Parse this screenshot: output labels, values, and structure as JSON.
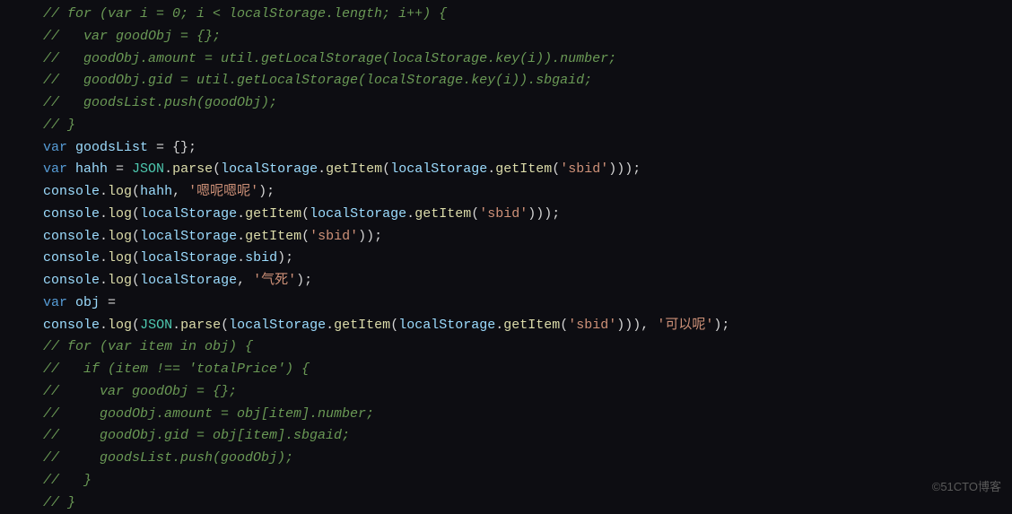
{
  "lines": [
    {
      "type": "comment",
      "text": "// for (var i = 0; i < localStorage.length; i++) {"
    },
    {
      "type": "comment",
      "text": "//   var goodObj = {};"
    },
    {
      "type": "comment",
      "text": "//   goodObj.amount = util.getLocalStorage(localStorage.key(i)).number;"
    },
    {
      "type": "comment",
      "text": "//   goodObj.gid = util.getLocalStorage(localStorage.key(i)).sbgaid;"
    },
    {
      "type": "comment",
      "text": "//   goodsList.push(goodObj);"
    },
    {
      "type": "comment",
      "text": "// }"
    },
    {
      "type": "code",
      "tokens": [
        [
          "keyword",
          "var "
        ],
        [
          "variable",
          "goodsList"
        ],
        [
          "operator",
          " = "
        ],
        [
          "punct",
          "{};"
        ]
      ]
    },
    {
      "type": "code",
      "tokens": [
        [
          "keyword",
          "var "
        ],
        [
          "variable",
          "hahh"
        ],
        [
          "operator",
          " = "
        ],
        [
          "class",
          "JSON"
        ],
        [
          "punct",
          "."
        ],
        [
          "func",
          "parse"
        ],
        [
          "punct",
          "("
        ],
        [
          "object",
          "localStorage"
        ],
        [
          "punct",
          "."
        ],
        [
          "func",
          "getItem"
        ],
        [
          "punct",
          "("
        ],
        [
          "object",
          "localStorage"
        ],
        [
          "punct",
          "."
        ],
        [
          "func",
          "getItem"
        ],
        [
          "punct",
          "("
        ],
        [
          "string",
          "'sbid'"
        ],
        [
          "punct",
          ")));"
        ]
      ]
    },
    {
      "type": "code",
      "tokens": [
        [
          "object",
          "console"
        ],
        [
          "punct",
          "."
        ],
        [
          "func",
          "log"
        ],
        [
          "punct",
          "("
        ],
        [
          "variable",
          "hahh"
        ],
        [
          "punct",
          ", "
        ],
        [
          "string",
          "'嗯呢嗯呢'"
        ],
        [
          "punct",
          ");"
        ]
      ]
    },
    {
      "type": "code",
      "tokens": [
        [
          "object",
          "console"
        ],
        [
          "punct",
          "."
        ],
        [
          "func",
          "log"
        ],
        [
          "punct",
          "("
        ],
        [
          "object",
          "localStorage"
        ],
        [
          "punct",
          "."
        ],
        [
          "func",
          "getItem"
        ],
        [
          "punct",
          "("
        ],
        [
          "object",
          "localStorage"
        ],
        [
          "punct",
          "."
        ],
        [
          "func",
          "getItem"
        ],
        [
          "punct",
          "("
        ],
        [
          "string",
          "'sbid'"
        ],
        [
          "punct",
          ")));"
        ]
      ]
    },
    {
      "type": "code",
      "tokens": [
        [
          "object",
          "console"
        ],
        [
          "punct",
          "."
        ],
        [
          "func",
          "log"
        ],
        [
          "punct",
          "("
        ],
        [
          "object",
          "localStorage"
        ],
        [
          "punct",
          "."
        ],
        [
          "func",
          "getItem"
        ],
        [
          "punct",
          "("
        ],
        [
          "string",
          "'sbid'"
        ],
        [
          "punct",
          "));"
        ]
      ]
    },
    {
      "type": "code",
      "tokens": [
        [
          "object",
          "console"
        ],
        [
          "punct",
          "."
        ],
        [
          "func",
          "log"
        ],
        [
          "punct",
          "("
        ],
        [
          "object",
          "localStorage"
        ],
        [
          "punct",
          "."
        ],
        [
          "prop",
          "sbid"
        ],
        [
          "punct",
          ");"
        ]
      ]
    },
    {
      "type": "code",
      "tokens": [
        [
          "object",
          "console"
        ],
        [
          "punct",
          "."
        ],
        [
          "func",
          "log"
        ],
        [
          "punct",
          "("
        ],
        [
          "object",
          "localStorage"
        ],
        [
          "punct",
          ", "
        ],
        [
          "string",
          "'气死'"
        ],
        [
          "punct",
          ");"
        ]
      ]
    },
    {
      "type": "code",
      "tokens": [
        [
          "keyword",
          "var "
        ],
        [
          "variable",
          "obj"
        ],
        [
          "operator",
          " ="
        ]
      ]
    },
    {
      "type": "code",
      "tokens": [
        [
          "object",
          "console"
        ],
        [
          "punct",
          "."
        ],
        [
          "func",
          "log"
        ],
        [
          "punct",
          "("
        ],
        [
          "class",
          "JSON"
        ],
        [
          "punct",
          "."
        ],
        [
          "func",
          "parse"
        ],
        [
          "punct",
          "("
        ],
        [
          "object",
          "localStorage"
        ],
        [
          "punct",
          "."
        ],
        [
          "func",
          "getItem"
        ],
        [
          "punct",
          "("
        ],
        [
          "object",
          "localStorage"
        ],
        [
          "punct",
          "."
        ],
        [
          "func",
          "getItem"
        ],
        [
          "punct",
          "("
        ],
        [
          "string",
          "'sbid'"
        ],
        [
          "punct",
          "))), "
        ],
        [
          "string",
          "'可以呢'"
        ],
        [
          "punct",
          ");"
        ]
      ]
    },
    {
      "type": "comment",
      "text": "// for (var item in obj) {"
    },
    {
      "type": "comment",
      "text": "//   if (item !== 'totalPrice') {"
    },
    {
      "type": "comment",
      "text": "//     var goodObj = {};"
    },
    {
      "type": "comment",
      "text": "//     goodObj.amount = obj[item].number;"
    },
    {
      "type": "comment",
      "text": "//     goodObj.gid = obj[item].sbgaid;"
    },
    {
      "type": "comment",
      "text": "//     goodsList.push(goodObj);"
    },
    {
      "type": "comment",
      "text": "//   }"
    },
    {
      "type": "comment",
      "text": "// }"
    }
  ],
  "watermark": "©51CTO博客"
}
